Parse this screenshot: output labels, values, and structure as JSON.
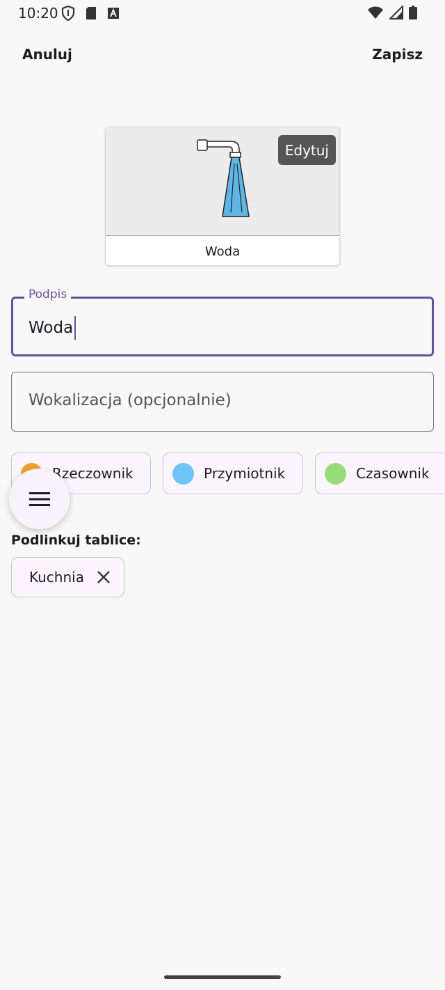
{
  "status_bar": {
    "time": "10:20"
  },
  "header": {
    "cancel_label": "Anuluj",
    "save_label": "Zapisz"
  },
  "card": {
    "edit_label": "Edytuj",
    "caption": "Woda",
    "image_icon": "water-tap-icon"
  },
  "fields": {
    "caption_label": "Podpis",
    "caption_value": "Woda",
    "vocalization_placeholder": "Wokalizacja (opcjonalnie)"
  },
  "categories": [
    {
      "label": "Rzeczownik",
      "color": "#f0a030"
    },
    {
      "label": "Przymiotnik",
      "color": "#6ec4f8"
    },
    {
      "label": "Czasownik",
      "color": "#98dc78"
    }
  ],
  "menu_icon": "menu-icon",
  "links": {
    "title": "Podlinkuj tablice:",
    "boards": [
      {
        "label": "Kuchnia"
      }
    ]
  },
  "colors": {
    "accent": "#6750a4",
    "chip_bg": "#fdf5fd"
  }
}
